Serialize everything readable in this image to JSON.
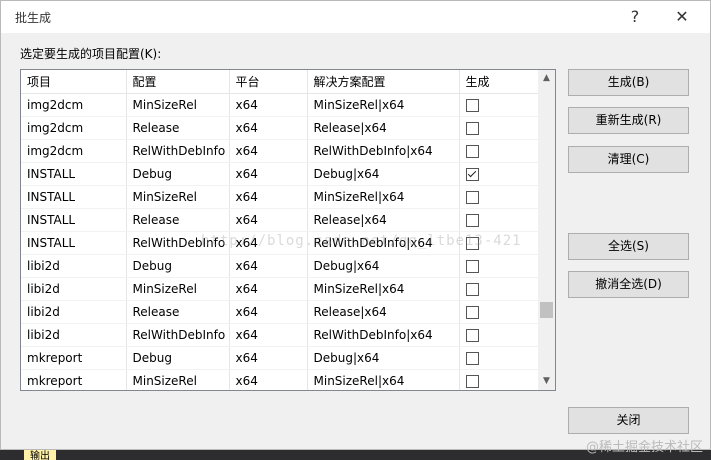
{
  "dialog": {
    "title": "批生成",
    "help_glyph": "?",
    "close_glyph": "✕",
    "select_label": "选定要生成的项目配置(K):"
  },
  "columns": [
    "项目",
    "配置",
    "平台",
    "解决方案配置",
    "生成"
  ],
  "rows": [
    {
      "project": "img2dcm",
      "config": "MinSizeRel",
      "platform": "x64",
      "solution_config": "MinSizeRel|x64",
      "build": false
    },
    {
      "project": "img2dcm",
      "config": "Release",
      "platform": "x64",
      "solution_config": "Release|x64",
      "build": false
    },
    {
      "project": "img2dcm",
      "config": "RelWithDebInfo",
      "platform": "x64",
      "solution_config": "RelWithDebInfo|x64",
      "build": false
    },
    {
      "project": "INSTALL",
      "config": "Debug",
      "platform": "x64",
      "solution_config": "Debug|x64",
      "build": true
    },
    {
      "project": "INSTALL",
      "config": "MinSizeRel",
      "platform": "x64",
      "solution_config": "MinSizeRel|x64",
      "build": false
    },
    {
      "project": "INSTALL",
      "config": "Release",
      "platform": "x64",
      "solution_config": "Release|x64",
      "build": false
    },
    {
      "project": "INSTALL",
      "config": "RelWithDebInfo",
      "platform": "x64",
      "solution_config": "RelWithDebInfo|x64",
      "build": false
    },
    {
      "project": "libi2d",
      "config": "Debug",
      "platform": "x64",
      "solution_config": "Debug|x64",
      "build": false
    },
    {
      "project": "libi2d",
      "config": "MinSizeRel",
      "platform": "x64",
      "solution_config": "MinSizeRel|x64",
      "build": false
    },
    {
      "project": "libi2d",
      "config": "Release",
      "platform": "x64",
      "solution_config": "Release|x64",
      "build": false
    },
    {
      "project": "libi2d",
      "config": "RelWithDebInfo",
      "platform": "x64",
      "solution_config": "RelWithDebInfo|x64",
      "build": false
    },
    {
      "project": "mkreport",
      "config": "Debug",
      "platform": "x64",
      "solution_config": "Debug|x64",
      "build": false
    },
    {
      "project": "mkreport",
      "config": "MinSizeRel",
      "platform": "x64",
      "solution_config": "MinSizeRel|x64",
      "build": false
    }
  ],
  "buttons": {
    "build": "生成(B)",
    "rebuild": "重新生成(R)",
    "clean": "清理(C)",
    "select_all": "全选(S)",
    "deselect_all": "撤消全选(D)",
    "close": "关闭"
  },
  "watermark": "http://blog.csdn.net/qq_ltbe13-421",
  "background": {
    "output_tab": "输出",
    "credit": "@稀土掘金技术社区"
  }
}
